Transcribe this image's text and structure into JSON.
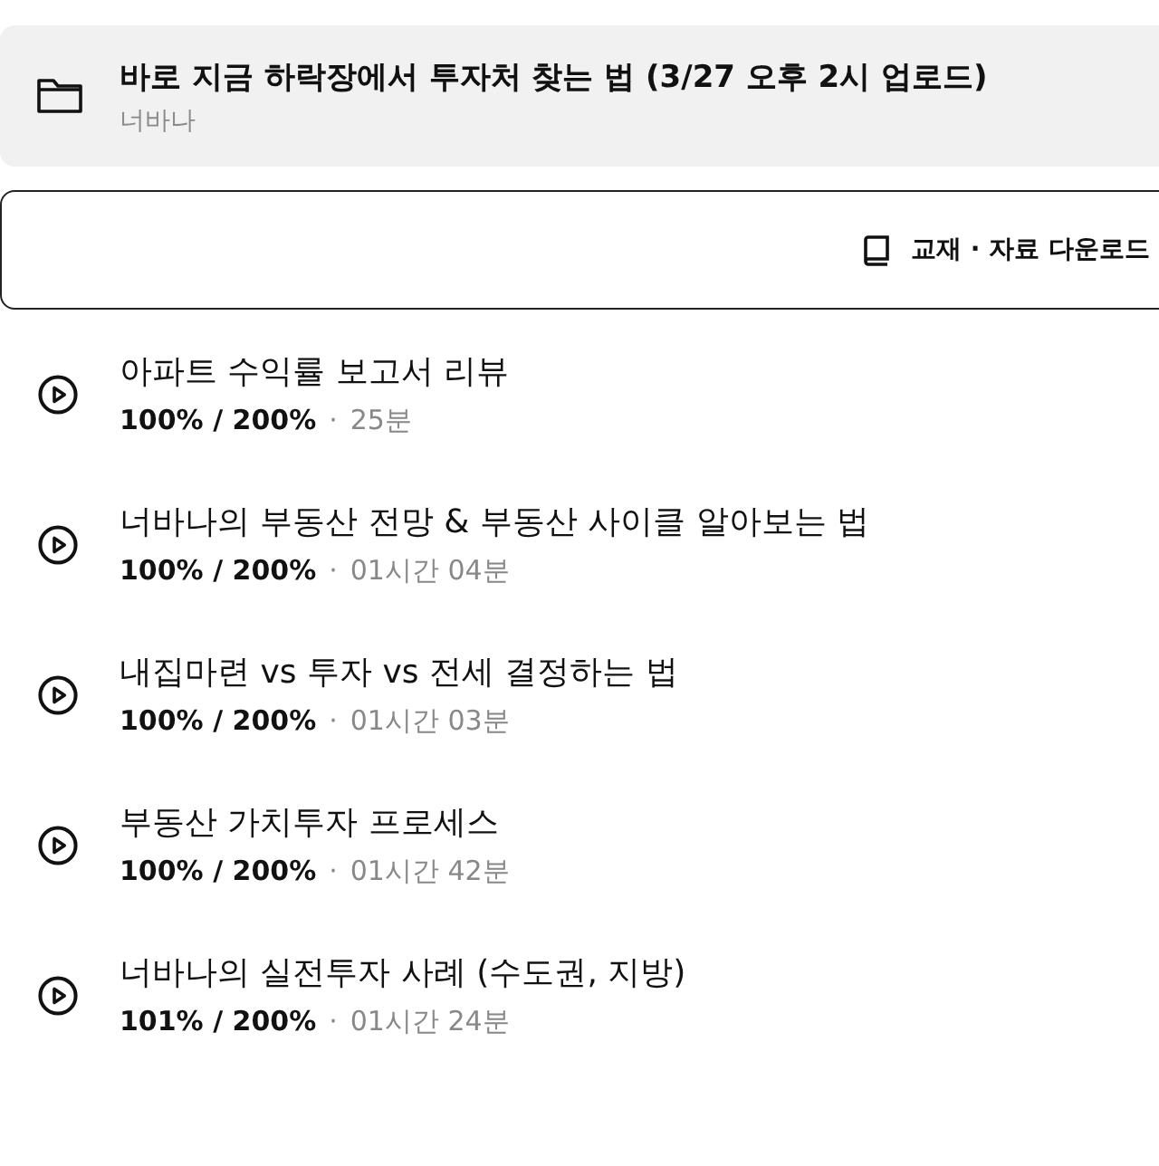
{
  "course": {
    "title": "바로 지금 하락장에서 투자처 찾는 법 (3/27 오후 2시 업로드)",
    "instructor": "너바나"
  },
  "download_button": {
    "label": "교재 · 자료 다운로드"
  },
  "lessons": [
    {
      "title": "아파트 수익률 보고서 리뷰",
      "progress": "100% / 200%",
      "separator": "·",
      "duration": "25분"
    },
    {
      "title": "너바나의 부동산 전망 & 부동산 사이클 알아보는 법",
      "progress": "100% / 200%",
      "separator": "·",
      "duration": "01시간 04분"
    },
    {
      "title": "내집마련 vs 투자 vs 전세 결정하는 법",
      "progress": "100% / 200%",
      "separator": "·",
      "duration": "01시간 03분"
    },
    {
      "title": "부동산 가치투자 프로세스",
      "progress": "100% / 200%",
      "separator": "·",
      "duration": "01시간 42분"
    },
    {
      "title": "너바나의 실전투자 사례 (수도권, 지방)",
      "progress": "101% / 200%",
      "separator": "·",
      "duration": "01시간 24분"
    }
  ]
}
